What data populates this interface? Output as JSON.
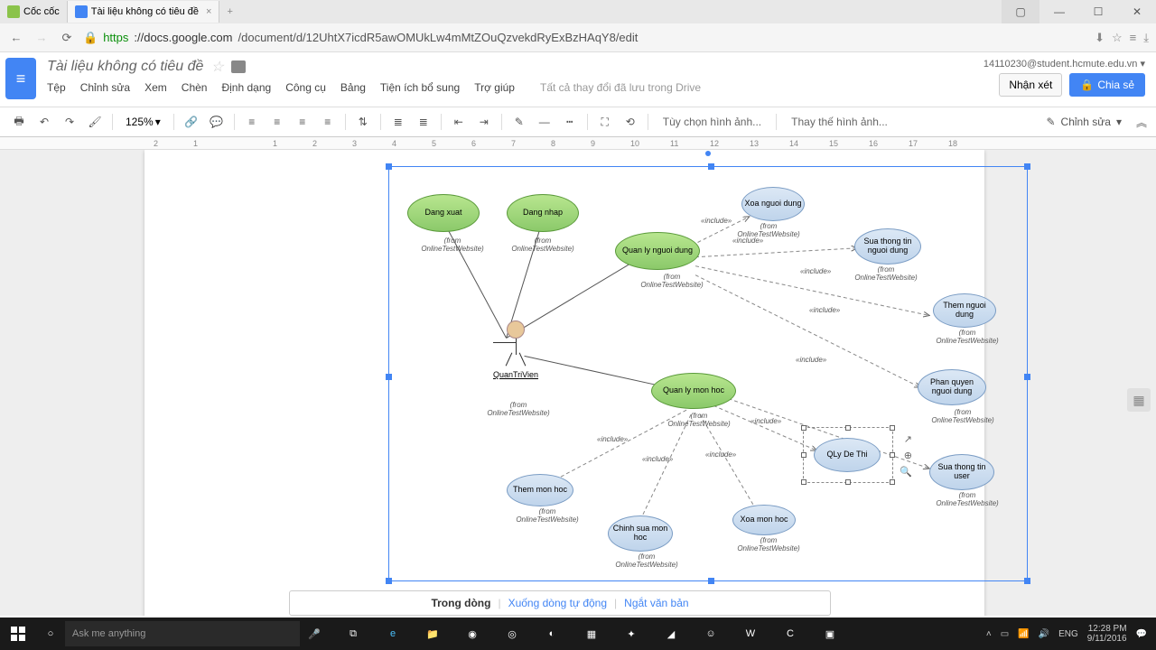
{
  "browser": {
    "tab1": "Cốc cốc",
    "tab2": "Tài liệu không có tiêu đề",
    "url_scheme": "https",
    "url_domain": "://docs.google.com",
    "url_path": "/document/d/12UhtX7icdR5awOMUkLw4mMtZOuQzvekdRyExBzHAqY8/edit"
  },
  "docs": {
    "title": "Tài liệu không có tiêu đề",
    "user_email": "14110230@student.hcmute.edu.vn",
    "btn_comment": "Nhận xét",
    "btn_share": "Chia sẻ",
    "menu": {
      "m1": "Tệp",
      "m2": "Chỉnh sửa",
      "m3": "Xem",
      "m4": "Chèn",
      "m5": "Định dạng",
      "m6": "Công cụ",
      "m7": "Bảng",
      "m8": "Tiện ích bổ sung",
      "m9": "Trợ giúp"
    },
    "save_status": "Tất cả thay đổi đã lưu trong Drive",
    "zoom": "125%",
    "img_opt": "Tùy chọn hình ảnh...",
    "img_replace": "Thay thế hình ảnh...",
    "edit_mode": "Chỉnh sửa"
  },
  "ruler": [
    "2",
    "1",
    "",
    "1",
    "2",
    "3",
    "4",
    "5",
    "6",
    "7",
    "8",
    "9",
    "10",
    "11",
    "12",
    "13",
    "14",
    "15",
    "16",
    "17",
    "18"
  ],
  "wrap": {
    "w1": "Trong dòng",
    "w2": "Xuống dòng tự động",
    "w3": "Ngắt văn bản"
  },
  "diagram": {
    "n1": "Dang xuat",
    "n2": "Dang nhap",
    "n3": "Quan ly nguoi dung",
    "n4": "Xoa nguoi dung",
    "n5": "Sua thong tin nguoi dung",
    "n6": "Them nguoi dung",
    "n7": "Phan quyen nguoi dung",
    "n8": "Quan ly mon hoc",
    "n9": "QLy De Thi",
    "n10": "Sua thong tin user",
    "n11": "Them mon hoc",
    "n12": "Chinh sua mon hoc",
    "n13": "Xoa mon hoc",
    "actor": "QuanTriVien",
    "from": "(from OnlineTestWebsite)",
    "include": "«include»"
  },
  "taskbar": {
    "search_placeholder": "Ask me anything",
    "lang": "ENG",
    "time": "12:28 PM",
    "date": "9/11/2016"
  }
}
